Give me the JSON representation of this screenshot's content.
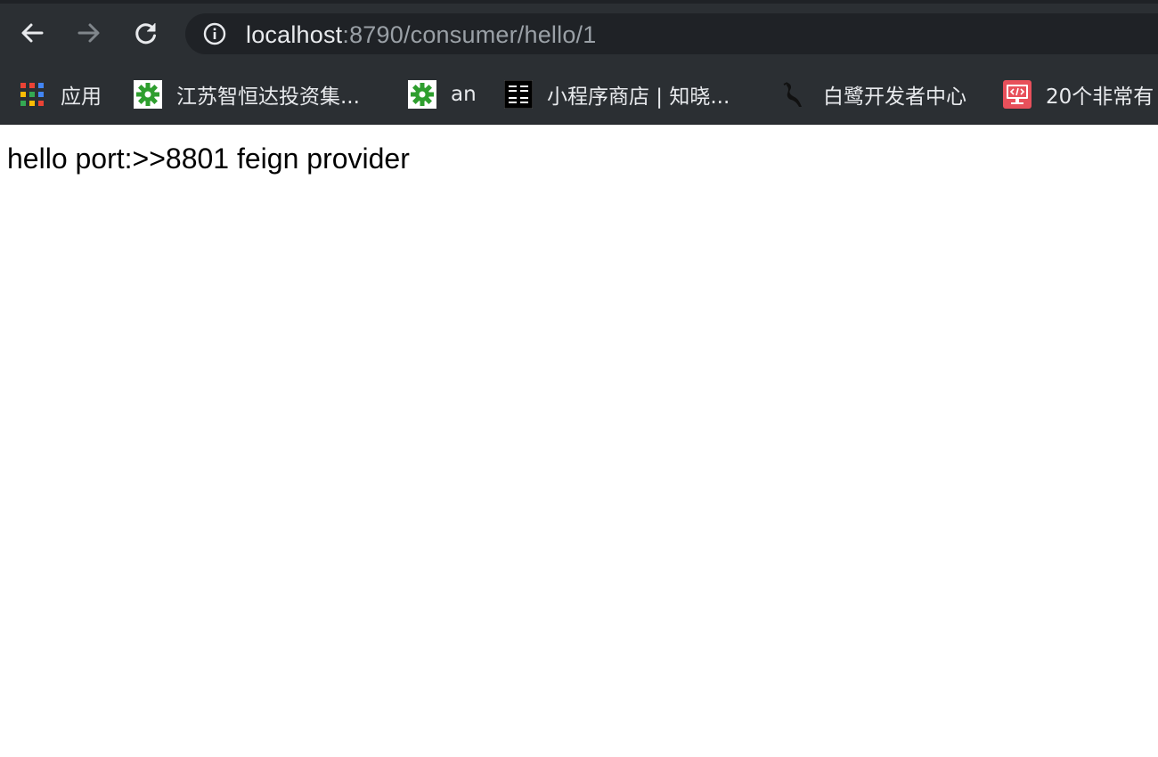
{
  "toolbar": {
    "url_host": "localhost",
    "url_path": ":8790/consumer/hello/1"
  },
  "bookmarks": [
    {
      "label": "应用",
      "icon": "apps-grid-icon"
    },
    {
      "label": "江苏智恒达投资集...",
      "icon": "green-gear-icon"
    },
    {
      "label": "an",
      "icon": "green-gear-icon"
    },
    {
      "label": "小程序商店 | 知晓...",
      "icon": "zhixiao-logo-icon"
    },
    {
      "label": "白鹭开发者中心",
      "icon": "egret-bird-icon"
    },
    {
      "label": "20个非常有",
      "icon": "code-monitor-icon"
    }
  ],
  "page": {
    "text": "hello port:>>8801 feign provider"
  },
  "colors": {
    "chrome_bg": "#2b2f33",
    "omnibox_bg": "#1f2226",
    "url_host": "#e8eaed",
    "url_path": "#9aa0a6"
  }
}
